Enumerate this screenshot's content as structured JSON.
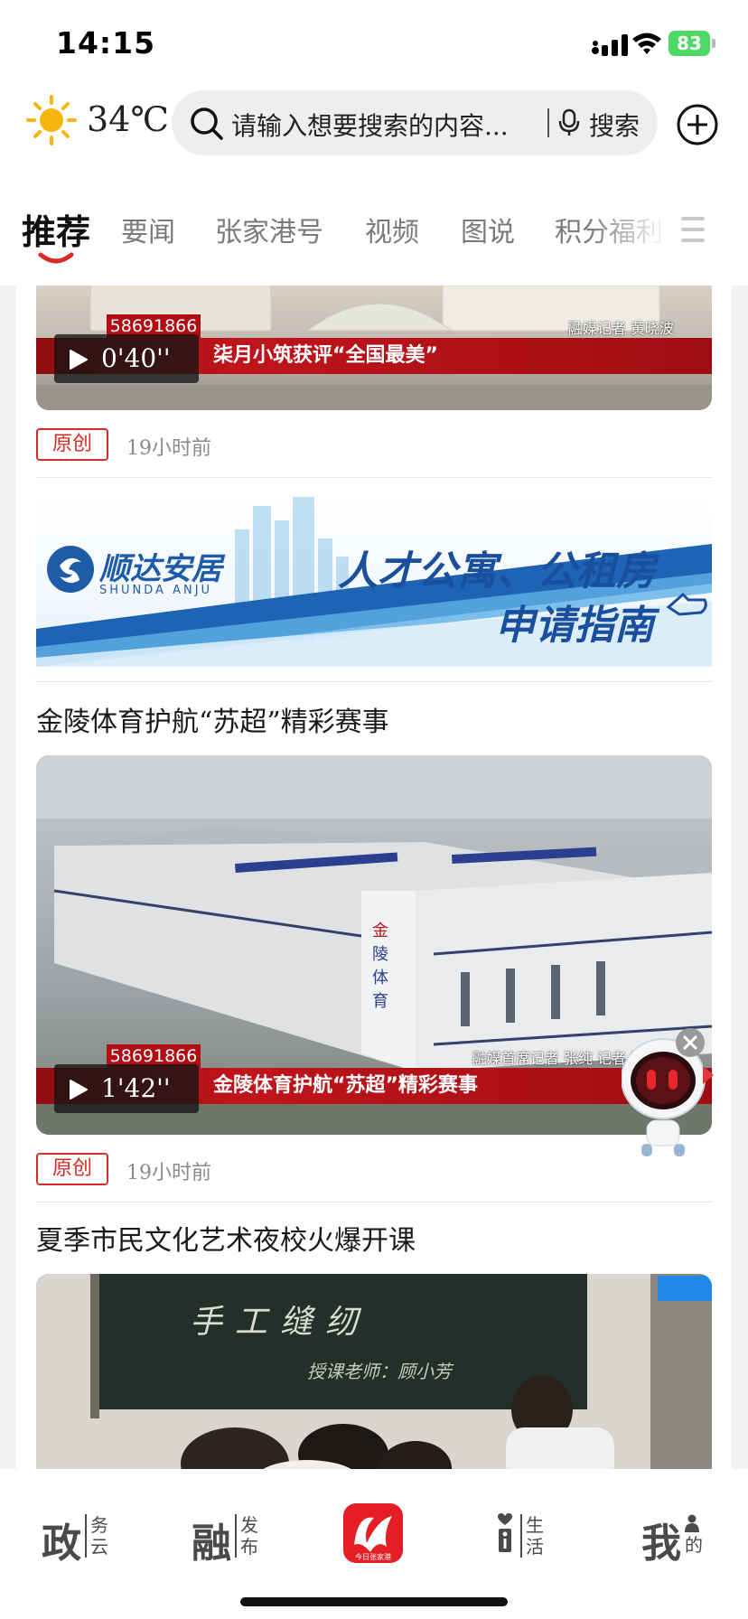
{
  "status_bar": {
    "time": "14:15",
    "battery": "83"
  },
  "header": {
    "temperature": "34℃",
    "search_placeholder": "请输入想要搜索的内容...",
    "search_button": "搜索"
  },
  "tabs": [
    "推荐",
    "要闻",
    "张家港号",
    "视频",
    "图说",
    "积分福利"
  ],
  "feed": {
    "item1": {
      "hotline": "58691866",
      "caption": "柒月小筑获评“全国最美”",
      "reporter": "融媒记者  黄晓波",
      "duration": "0'40''",
      "badge": "原创",
      "time_ago": "19小时前"
    },
    "banner": {
      "brand": "顺达安居",
      "brand_en": "SHUNDA ANJU",
      "line1": "人才公寓、公租房",
      "line2": "申请指南"
    },
    "item2": {
      "title": "金陵体育护航“苏超”精彩赛事",
      "hotline": "58691866",
      "caption": "金陵体育护航“苏超”精彩赛事",
      "reporter": "融媒首席记者  张纯  记者  陶啸天",
      "duration": "1'42''",
      "badge": "原创",
      "time_ago": "19小时前"
    },
    "item3": {
      "title": "夏季市民文化艺术夜校火爆开课",
      "board_text": "手工缝纫",
      "board_sub": "授课老师：顾小芳"
    }
  },
  "bottom_nav": [
    {
      "big": "政",
      "small": "务云"
    },
    {
      "big": "融",
      "small": "发布"
    },
    {
      "big": "今日张家港",
      "small": ""
    },
    {
      "big": "i",
      "small": "生活"
    },
    {
      "big": "我",
      "small": "的"
    }
  ],
  "colors": {
    "accent": "#d92b25",
    "brand_blue": "#1a4f9e",
    "caption_red": "#b30d13"
  }
}
